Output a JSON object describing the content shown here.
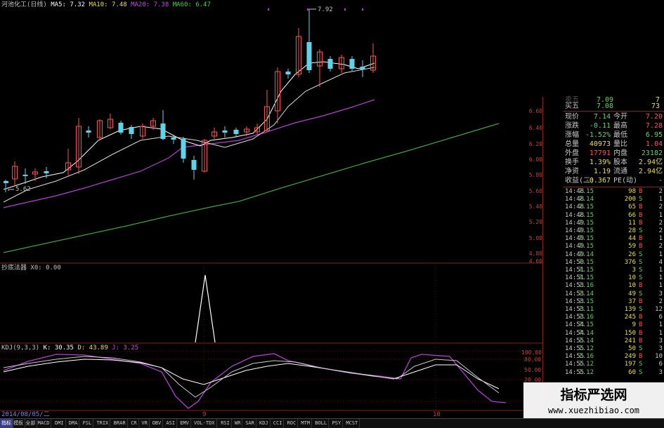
{
  "main_legend": {
    "stock": "河池化工(日线)",
    "ma5": "MA5: 7.32",
    "ma10": "MA10: 7.48",
    "ma20": "MA20: 7.38",
    "ma60": "MA60: 6.47",
    "high_marker": "7.92",
    "low_marker": "5.62"
  },
  "panel2_legend": "抄底法器 X0: 0.00",
  "kdj_legend": {
    "name": "KDJ(9,3,3)",
    "k": "K: 30.35",
    "d": "D: 43.89",
    "j": "J: 3.25"
  },
  "kdj_axis": [
    "100.00",
    "80.00",
    "50.00",
    "20.00"
  ],
  "price_axis": [
    "6.60",
    "6.40",
    "6.20",
    "6.00",
    "5.80",
    "5.60",
    "5.40",
    "5.20",
    "5.00",
    "4.80",
    "4.60"
  ],
  "date_label": "2014/08/05/二",
  "x_markers": [
    "9",
    "10"
  ],
  "quote": {
    "sell5": {
      "label": "卖五",
      "price": "7.09",
      "vol": "7"
    },
    "buy5": {
      "label": "买五",
      "price": "7.08",
      "vol": "73"
    },
    "rows": [
      {
        "l1": "现价",
        "v1": "7.14",
        "l2": "今开",
        "v2": "7.20",
        "c1": "#5fd35f",
        "c2": "#ff5050"
      },
      {
        "l1": "涨跌",
        "v1": "-0.11",
        "l2": "最高",
        "v2": "7.28",
        "c1": "#5fd35f",
        "c2": "#ff5050"
      },
      {
        "l1": "涨幅",
        "v1": "-1.52%",
        "l2": "最低",
        "v2": "6.95",
        "c1": "#5fd35f",
        "c2": "#5fd35f"
      },
      {
        "l1": "总量",
        "v1": "40973",
        "l2": "量比",
        "v2": "1.04",
        "c1": "#e8e030",
        "c2": "#ff5050"
      },
      {
        "l1": "外盘",
        "v1": "17791",
        "l2": "内盘",
        "v2": "23182",
        "c1": "#ff5050",
        "c2": "#5fd35f"
      },
      {
        "l1": "换手",
        "v1": "1.39%",
        "l2": "股本",
        "v2": "2.94亿",
        "c1": "#e8e030",
        "c2": "#e8e030"
      },
      {
        "l1": "净资",
        "v1": "1.19",
        "l2": "流通",
        "v2": "2.94亿",
        "c1": "#e8e030",
        "c2": "#e8e030"
      },
      {
        "l1": "收益(二)",
        "v1": "-0.367",
        "l2": "PE(动)",
        "v2": "-",
        "c1": "#e8e030",
        "c2": "#c0c0c0"
      }
    ],
    "ticks": [
      {
        "t": "14:48",
        "p": "7.15",
        "v": "98",
        "s": "B",
        "n": "2"
      },
      {
        "t": "14:48",
        "p": "7.14",
        "v": "200",
        "s": "S",
        "n": "1"
      },
      {
        "t": "14:48",
        "p": "7.15",
        "v": "65",
        "s": "B",
        "n": "2"
      },
      {
        "t": "14:48",
        "p": "7.15",
        "v": "66",
        "s": "B",
        "n": "1"
      },
      {
        "t": "14:49",
        "p": "7.15",
        "v": "11",
        "s": "B",
        "n": "2"
      },
      {
        "t": "14:49",
        "p": "7.15",
        "v": "28",
        "s": "S",
        "n": "2"
      },
      {
        "t": "14:49",
        "p": "7.15",
        "v": "44",
        "s": "B",
        "n": "1"
      },
      {
        "t": "14:49",
        "p": "7.15",
        "v": "59",
        "s": "B",
        "n": "2"
      },
      {
        "t": "14:49",
        "p": "7.14",
        "v": "26",
        "s": "S",
        "n": "1"
      },
      {
        "t": "14:50",
        "p": "7.15",
        "v": "376",
        "s": "S",
        "n": "4"
      },
      {
        "t": "14:51",
        "p": "7.15",
        "v": "3",
        "s": "S",
        "n": "1"
      },
      {
        "t": "14:51",
        "p": "7.15",
        "v": "10",
        "s": "S",
        "n": "1"
      },
      {
        "t": "14:53",
        "p": "7.16",
        "v": "10",
        "s": "B",
        "n": "1"
      },
      {
        "t": "14:53",
        "p": "7.14",
        "v": "49",
        "s": "S",
        "n": "3"
      },
      {
        "t": "14:53",
        "p": "7.15",
        "v": "37",
        "s": "B",
        "n": "2"
      },
      {
        "t": "14:53",
        "p": "7.11",
        "v": "139",
        "s": "S",
        "n": "12"
      },
      {
        "t": "14:53",
        "p": "7.16",
        "v": "245",
        "s": "B",
        "n": "6"
      },
      {
        "t": "14:54",
        "p": "7.15",
        "v": "9",
        "s": "B",
        "n": "1"
      },
      {
        "t": "14:54",
        "p": "7.14",
        "v": "150",
        "s": "B",
        "n": "1"
      },
      {
        "t": "14:55",
        "p": "7.14",
        "v": "241",
        "s": "B",
        "n": "3"
      },
      {
        "t": "14:55",
        "p": "7.12",
        "v": "50",
        "s": "S",
        "n": "3"
      },
      {
        "t": "14:55",
        "p": "7.16",
        "v": "249",
        "s": "B",
        "n": "10"
      },
      {
        "t": "14:55",
        "p": "7.12",
        "v": "197",
        "s": "S",
        "n": "6"
      },
      {
        "t": "14:55",
        "p": "7.12",
        "v": "60",
        "s": "S",
        "n": "3"
      }
    ]
  },
  "toolbar": [
    "指标",
    "模板",
    "全部",
    "MACD",
    "DMI",
    "DMA",
    "FSL",
    "TRIX",
    "BRAR",
    "CR",
    "VR",
    "OBV",
    "ASI",
    "EMV",
    "VOL-TDX",
    "RSI",
    "WR",
    "SAR",
    "KDJ",
    "CCI",
    "ROC",
    "MTM",
    "BOLL",
    "PSY",
    "MCST"
  ],
  "watermark": {
    "title": "指标严选网",
    "url": "www.xuezhibiao.com"
  },
  "colors": {
    "up": "#ff5050",
    "down": "#5fd3e8",
    "ma5": "#ffffff",
    "ma10": "#e8e8e8",
    "ma20": "#b040d0",
    "ma60": "#3f9f3f",
    "grid": "#8a1c1c"
  }
}
